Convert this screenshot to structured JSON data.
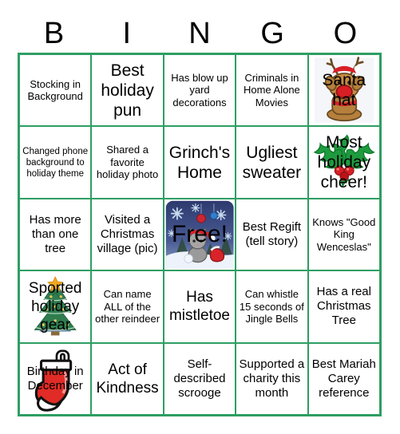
{
  "header": {
    "letters": [
      "B",
      "I",
      "N",
      "G",
      "O"
    ]
  },
  "colors": {
    "grid_border": "#2e9e63",
    "cell_background": "#ffffff",
    "text": "#000000",
    "holly_green": "#1f9b3f",
    "berry_red": "#d81f26",
    "stocking_red": "#e02b26",
    "tree_green": "#2f7d4f",
    "star_gold": "#f0a81e",
    "reindeer_brown": "#b5803c",
    "snow_blue": "#3e4f8c"
  },
  "grid": {
    "rows": 5,
    "columns": 5,
    "cells": [
      [
        {
          "text": "Stocking in Background",
          "size": "ts-s",
          "art": "none"
        },
        {
          "text": "Best holiday pun",
          "size": "ts-xl",
          "art": "none"
        },
        {
          "text": "Has blow up yard decorations",
          "size": "ts-s",
          "art": "none"
        },
        {
          "text": "Criminals in Home Alone Movies",
          "size": "ts-s",
          "art": "none"
        },
        {
          "text": "Santa hat",
          "size": "ts-xl",
          "art": "reindeer"
        }
      ],
      [
        {
          "text": "Changed phone background to holiday theme",
          "size": "ts-xs",
          "art": "none"
        },
        {
          "text": "Shared a favorite holiday photo",
          "size": "ts-s",
          "art": "none"
        },
        {
          "text": "Grinch's Home",
          "size": "ts-xl",
          "art": "none"
        },
        {
          "text": "Ugliest sweater",
          "size": "ts-xl",
          "art": "none"
        },
        {
          "text": "Most holiday cheer!",
          "size": "ts-xl",
          "art": "holly"
        }
      ],
      [
        {
          "text": "Has more than one tree",
          "size": "ts-m",
          "art": "none"
        },
        {
          "text": "Visited a Christmas village (pic)",
          "size": "ts-m",
          "art": "none"
        },
        {
          "text": "Free!",
          "size": "ts-free",
          "art": "snow-cat"
        },
        {
          "text": "Best Regift (tell story)",
          "size": "ts-m",
          "art": "none"
        },
        {
          "text": "Knows \"Good King Wenceslas\"",
          "size": "ts-s",
          "art": "none"
        }
      ],
      [
        {
          "text": "Sported holiday gear",
          "size": "ts-l",
          "art": "tree"
        },
        {
          "text": "Can name ALL of the other reindeer",
          "size": "ts-s",
          "art": "none"
        },
        {
          "text": "Has mistletoe",
          "size": "ts-l",
          "art": "none"
        },
        {
          "text": "Can whistle 15 seconds of Jingle Bells",
          "size": "ts-s",
          "art": "none"
        },
        {
          "text": "Has a real Christmas Tree",
          "size": "ts-m",
          "art": "none"
        }
      ],
      [
        {
          "text": "Birthday in December",
          "size": "ts-m",
          "art": "stocking"
        },
        {
          "text": "Act of Kindness",
          "size": "ts-l",
          "art": "none"
        },
        {
          "text": "Self-described scrooge",
          "size": "ts-m",
          "art": "none"
        },
        {
          "text": "Supported a charity this month",
          "size": "ts-m",
          "art": "none"
        },
        {
          "text": "Best Mariah Carey reference",
          "size": "ts-m",
          "art": "none"
        }
      ]
    ]
  }
}
